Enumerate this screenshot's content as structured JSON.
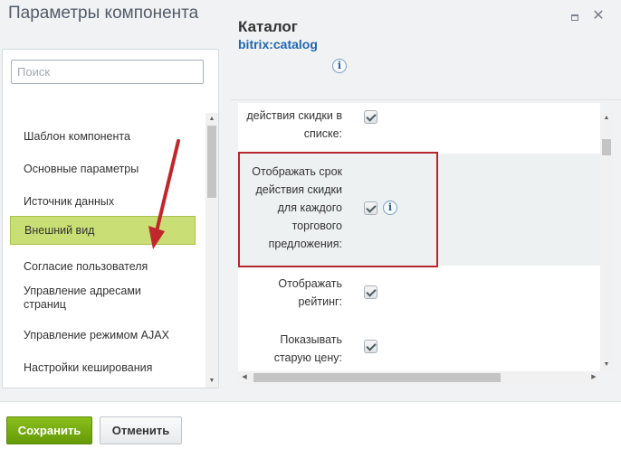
{
  "window": {
    "title": "Параметры компонента",
    "maximize_icon": "maximize-icon",
    "close_icon": "close-icon",
    "close_glyph": "✕"
  },
  "sidebar": {
    "search_placeholder": "Поиск",
    "items": [
      {
        "label": "Шаблон компонента",
        "active": false
      },
      {
        "label": "Основные параметры",
        "active": false
      },
      {
        "label": "Источник данных",
        "active": false
      },
      {
        "label": "Внешний вид",
        "active": true
      },
      {
        "label": "Согласие пользователя",
        "active": false
      },
      {
        "label": "Управление адресами страниц",
        "active": false
      },
      {
        "label": "Управление режимом AJAX",
        "active": false
      },
      {
        "label": "Настройки кеширования",
        "active": false
      }
    ]
  },
  "component": {
    "name": "Каталог",
    "code": "bitrix:catalog",
    "info_glyph": "i"
  },
  "properties": [
    {
      "lines": [
        "действия скидки в",
        "списке:"
      ],
      "checked": true
    },
    {
      "lines": [
        "Отображать срок",
        "действия скидки",
        "для каждого",
        "торгового",
        "предложения:"
      ],
      "checked": true,
      "highlighted": true,
      "has_info": true
    },
    {
      "lines": [
        "Отображать",
        "рейтинг:"
      ],
      "checked": true
    },
    {
      "lines": [
        "Показывать",
        "старую цену:"
      ],
      "checked": true
    }
  ],
  "footer": {
    "save_label": "Сохранить",
    "cancel_label": "Отменить"
  },
  "colors": {
    "active_item": "#c9de74",
    "save_button": "#76ad10",
    "highlight_border": "#b5282e",
    "arrow": "#c0272d",
    "link": "#2067b0"
  }
}
